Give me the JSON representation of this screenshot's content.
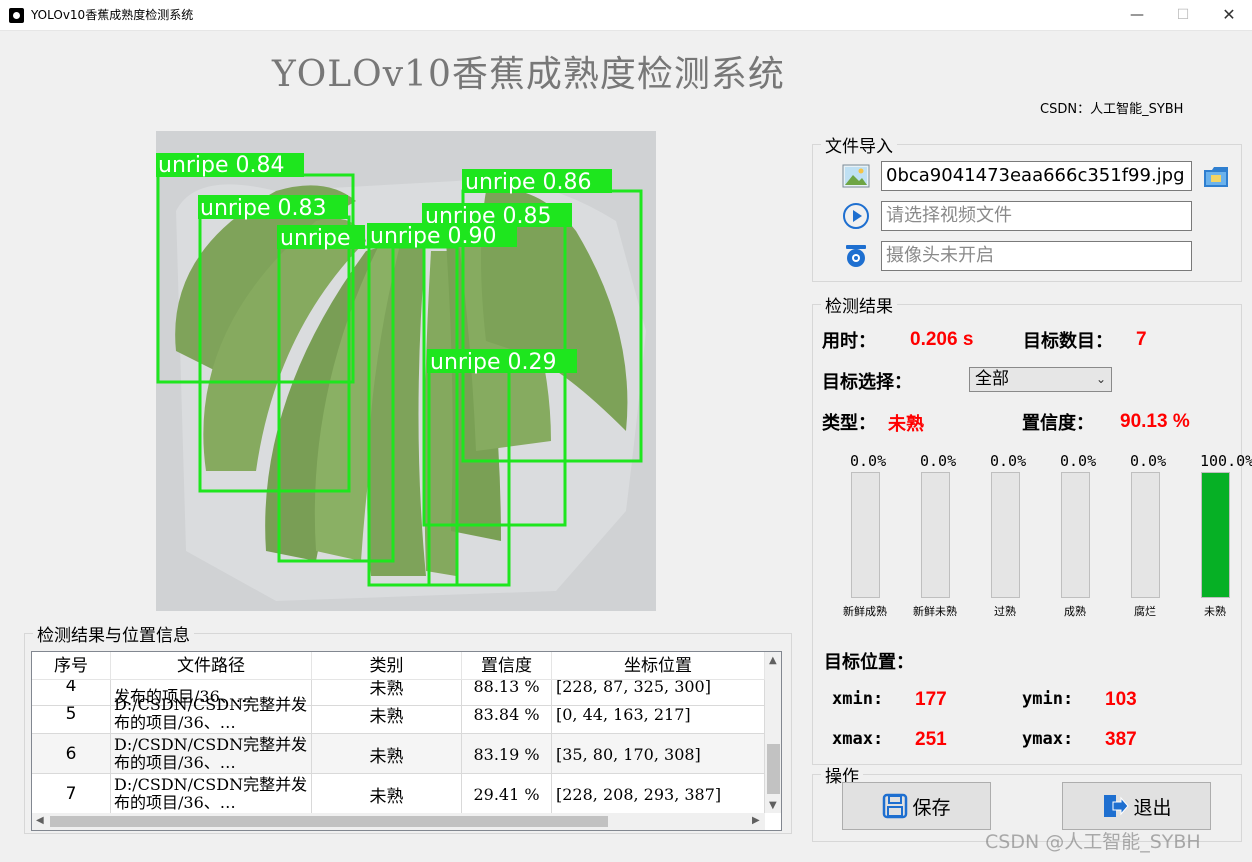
{
  "window": {
    "title": "YOLOv10香蕉成熟度检测系统",
    "min_label": "—",
    "max_label": "☐",
    "close_label": "✕"
  },
  "header": {
    "title": "YOLOv10香蕉成熟度检测系统",
    "author": "CSDN：人工智能_SYBH"
  },
  "image": {
    "detections": [
      {
        "label": "unripe 0.84"
      },
      {
        "label": "unripe 0.83"
      },
      {
        "label": "unripe 0.86"
      },
      {
        "label": "unripe 0.85"
      },
      {
        "label": "unripe"
      },
      {
        "label": "unripe 0.90"
      },
      {
        "label": "unripe 0.29"
      }
    ],
    "box_color": "#1ee61e"
  },
  "file_import": {
    "legend": "文件导入",
    "image_value": "0bca9041473eaa666c351f99.jpg",
    "video_placeholder": "请选择视频文件",
    "camera_placeholder": "摄像头未开启",
    "icons": [
      "image-icon",
      "video-icon",
      "camera-icon",
      "folder-icon"
    ]
  },
  "result": {
    "legend": "检测结果",
    "time_label": "用时：",
    "time_value": "0.206 s",
    "count_label": "目标数目：",
    "count_value": "7",
    "select_label": "目标选择：",
    "select_value": "全部",
    "type_label": "类型：",
    "type_value": "未熟",
    "conf_label": "置信度：",
    "conf_value": "90.13 %",
    "bars": [
      {
        "name": "新鲜成熟",
        "pct_text": "0.0%",
        "value": 0.0
      },
      {
        "name": "新鲜未熟",
        "pct_text": "0.0%",
        "value": 0.0
      },
      {
        "name": "过熟",
        "pct_text": "0.0%",
        "value": 0.0
      },
      {
        "name": "成熟",
        "pct_text": "0.0%",
        "value": 0.0
      },
      {
        "name": "腐烂",
        "pct_text": "0.0%",
        "value": 0.0
      },
      {
        "name": "未熟",
        "pct_text": "100.0%",
        "value": 100.0
      }
    ],
    "bar_color": "#06b025",
    "position_label": "目标位置：",
    "xmin_label": "xmin:",
    "xmin_value": "177",
    "ymin_label": "ymin:",
    "ymin_value": "103",
    "xmax_label": "xmax:",
    "xmax_value": "251",
    "ymax_label": "ymax:",
    "ymax_value": "387"
  },
  "operations": {
    "legend": "操作",
    "save_label": "保存",
    "exit_label": "退出"
  },
  "table": {
    "legend": "检测结果与位置信息",
    "headers": [
      "序号",
      "文件路径",
      "类别",
      "置信度",
      "坐标位置"
    ],
    "partial_row": {
      "idx": "4",
      "path": "发布的项目/36、…",
      "cls": "未熟",
      "conf": "88.13 %",
      "coord": "[228, 87, 325, 300]"
    },
    "rows": [
      {
        "idx": "5",
        "path": "D:/CSDN/CSDN完整并发布的项目/36、…",
        "cls": "未熟",
        "conf": "83.84 %",
        "coord": "[0, 44, 163, 217]"
      },
      {
        "idx": "6",
        "path": "D:/CSDN/CSDN完整并发布的项目/36、…",
        "cls": "未熟",
        "conf": "83.19 %",
        "coord": "[35, 80, 170, 308]"
      },
      {
        "idx": "7",
        "path": "D:/CSDN/CSDN完整并发布的项目/36、…",
        "cls": "未熟",
        "conf": "29.41 %",
        "coord": "[228, 208, 293, 387]"
      }
    ]
  },
  "watermark": "CSDN @人工智能_SYBH"
}
